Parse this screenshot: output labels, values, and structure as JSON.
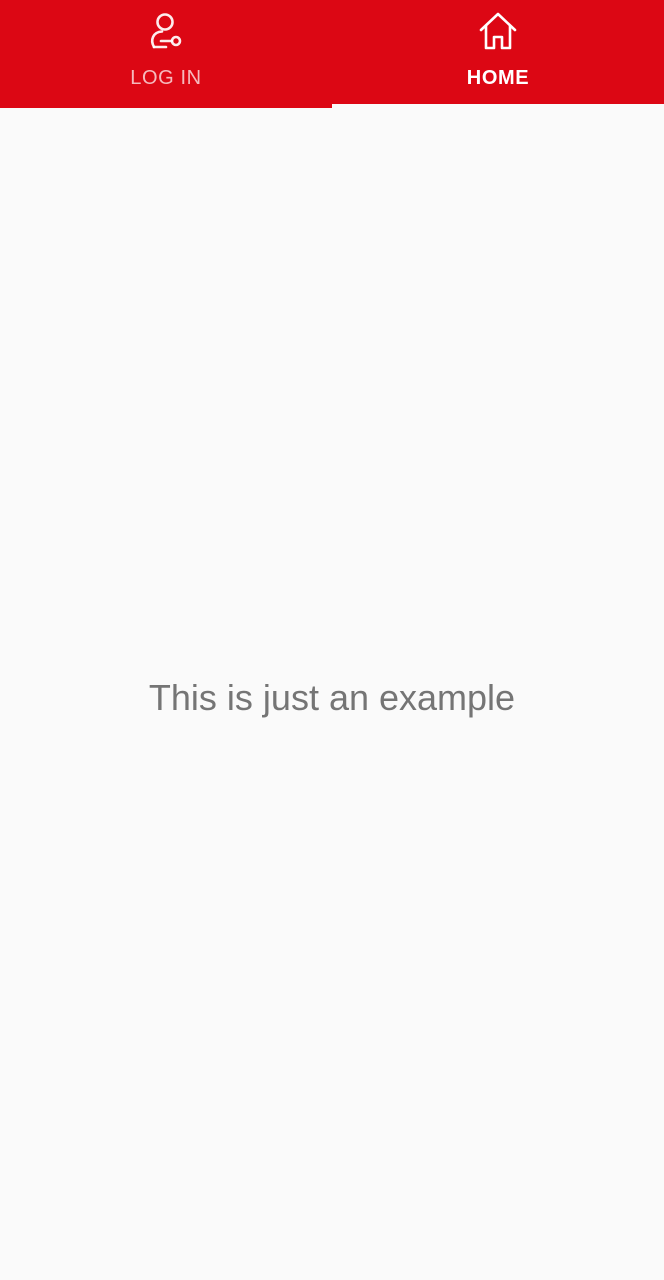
{
  "tabs": [
    {
      "label": "LOG IN",
      "icon": "user-key-icon",
      "selected": false
    },
    {
      "label": "HOME",
      "icon": "home-icon",
      "selected": true
    }
  ],
  "main": {
    "text": "This is just an example"
  },
  "colors": {
    "tab_bar": "#dc0714",
    "background": "#fafafa",
    "text": "#757575"
  }
}
